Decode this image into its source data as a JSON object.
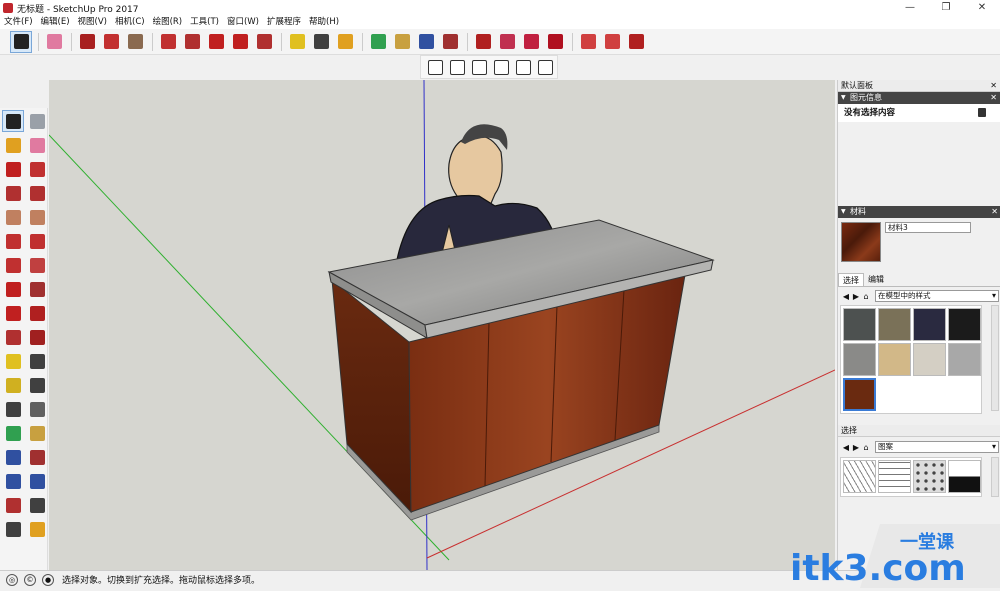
{
  "window": {
    "title": "无标题 - SketchUp Pro 2017",
    "controls": [
      "—",
      "❐",
      "✕"
    ]
  },
  "menu": [
    "文件(F)",
    "编辑(E)",
    "视图(V)",
    "相机(C)",
    "绘图(R)",
    "工具(T)",
    "窗口(W)",
    "扩展程序",
    "帮助(H)"
  ],
  "toolbar": {
    "icons": [
      "select-icon",
      "eraser-icon",
      "pencil-icon",
      "arc-icon",
      "rectangle-icon",
      "push-pull-icon",
      "offset-icon",
      "move-icon",
      "rotate-icon",
      "scale-icon",
      "tape-measure-icon",
      "text-icon",
      "paint-bucket-icon",
      "orbit-icon",
      "pan-icon",
      "zoom-icon",
      "zoom-extents-icon",
      "warehouse-icon",
      "extension-warehouse-icon",
      "layout-icon",
      "ruby-icon",
      "cloud-icon",
      "share-icon",
      "model-info-icon"
    ],
    "colors": [
      "#222222",
      "#e07aa0",
      "#a82020",
      "#c23030",
      "#8a6a50",
      "#c03030",
      "#b03030",
      "#c02020",
      "#c02020",
      "#b03030",
      "#e0c020",
      "#404040",
      "#e0a020",
      "#30a050",
      "#c8a040",
      "#3050a0",
      "#a03030",
      "#b02020",
      "#c03050",
      "#c02040",
      "#b01020",
      "#d04040",
      "#d04040",
      "#b02020"
    ]
  },
  "views": {
    "icons": [
      "iso-view-icon",
      "top-view-icon",
      "front-view-icon",
      "right-view-icon",
      "back-view-icon",
      "left-view-icon"
    ]
  },
  "left_toolbar": {
    "icons": [
      "select-icon",
      "component-icon",
      "paint-bucket-icon",
      "eraser-icon",
      "pencil-icon",
      "freehand-icon",
      "rectangle-icon",
      "rotated-rectangle-icon",
      "circle-icon",
      "polygon-icon",
      "arc-icon",
      "two-point-arc-icon",
      "three-point-arc-icon",
      "pie-icon",
      "move-icon",
      "push-pull-icon",
      "rotate-icon",
      "follow-me-icon",
      "scale-icon",
      "offset-icon",
      "tape-measure-icon",
      "dimension-icon",
      "protractor-icon",
      "text-icon",
      "axes-icon",
      "3d-text-icon",
      "orbit-icon",
      "pan-icon",
      "zoom-icon",
      "zoom-window-icon",
      "zoom-extents-icon",
      "previous-view-icon",
      "position-camera-icon",
      "look-around-icon",
      "walk-icon",
      "section-plane-icon"
    ],
    "colors": [
      "#222222",
      "#9aa0a8",
      "#e0a020",
      "#e07aa0",
      "#c02020",
      "#c03030",
      "#b03030",
      "#b03030",
      "#c08060",
      "#c08060",
      "#c03030",
      "#c03030",
      "#c03030",
      "#c04040",
      "#c02020",
      "#a03030",
      "#c02020",
      "#b02020",
      "#b03030",
      "#a02020",
      "#e0c020",
      "#404040",
      "#d0b020",
      "#404040",
      "#404040",
      "#606060",
      "#30a050",
      "#c8a040",
      "#3050a0",
      "#a03030",
      "#3050a0",
      "#3050a0",
      "#b03030",
      "#404040",
      "#404040",
      "#e0a020"
    ]
  },
  "panel": {
    "title": "默认面板",
    "entity_info": {
      "header": "图元信息",
      "text": "没有选择内容"
    },
    "materials": {
      "header": "材料",
      "name": "材料3",
      "tabs": [
        "选择",
        "编辑"
      ],
      "collection": "在模型中的样式",
      "swatches": [
        "#4d5150",
        "#7a7158",
        "#2a2a40",
        "#1b1b1b",
        "#8a8a88",
        "#d2b888",
        "#d4cfc4",
        "#a8a8a8",
        "#6a2a10"
      ]
    },
    "styles": {
      "header": "选择",
      "collection": "图案"
    }
  },
  "status": {
    "icons": [
      "geo-location-icon",
      "credits-icon",
      "user-icon"
    ],
    "text": "选择对象。切换到扩充选择。拖动鼠标选择多项。"
  },
  "watermark": {
    "text": "itk3.com",
    "badge": "一堂课"
  }
}
